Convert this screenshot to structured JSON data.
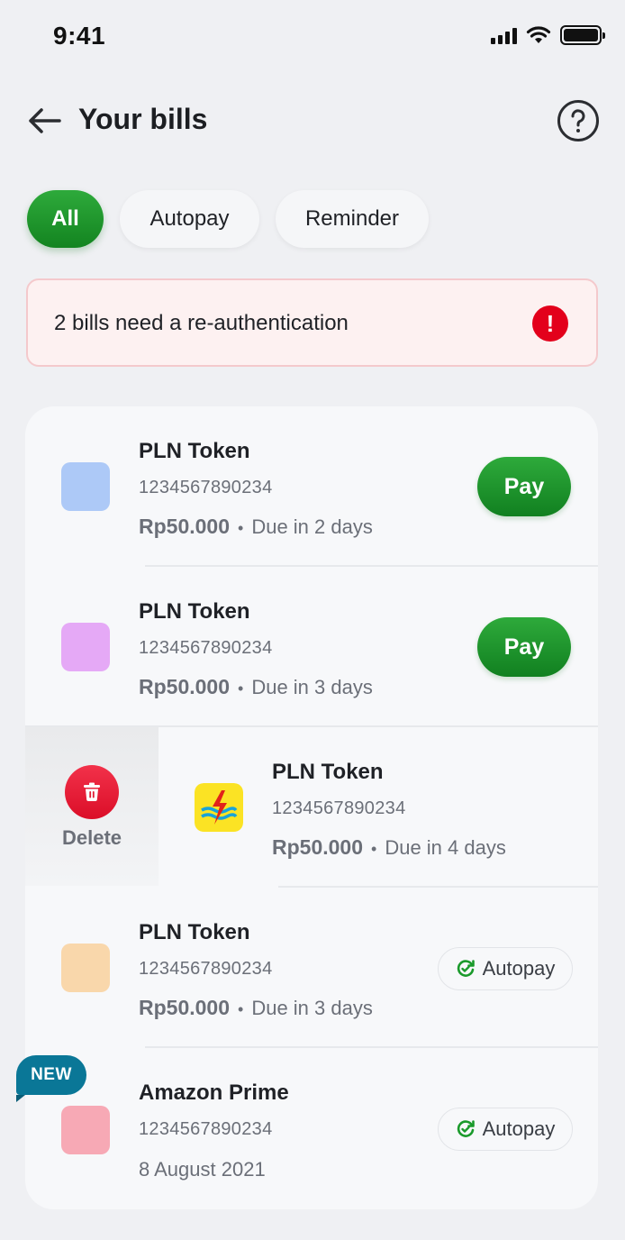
{
  "status_bar": {
    "time": "9:41"
  },
  "header": {
    "title": "Your bills"
  },
  "filters": [
    {
      "label": "All",
      "active": true
    },
    {
      "label": "Autopay",
      "active": false
    },
    {
      "label": "Reminder",
      "active": false
    }
  ],
  "alert": {
    "text": "2 bills need a re-authentication",
    "icon": "!"
  },
  "bills": [
    {
      "name": "PLN Token",
      "number": "1234567890234",
      "amount": "Rp50.000",
      "separator": "•",
      "due": "Due in 2 days",
      "action": "Pay",
      "logo_color": "#adc9f7"
    },
    {
      "name": "PLN Token",
      "number": "1234567890234",
      "amount": "Rp50.000",
      "separator": "•",
      "due": "Due in 3 days",
      "action": "Pay",
      "logo_color": "#e5a9f6"
    },
    {
      "name": "PLN Token",
      "number": "1234567890234",
      "amount": "Rp50.000",
      "separator": "•",
      "due": "Due in 4 days",
      "swipe_action": "Delete",
      "logo": "pln-logo"
    },
    {
      "name": "PLN Token",
      "number": "1234567890234",
      "amount": "Rp50.000",
      "separator": "•",
      "due": "Due in 3 days",
      "action": "Autopay",
      "logo_color": "#f9d7ab"
    },
    {
      "name": "Amazon Prime",
      "number": "1234567890234",
      "date": "8 August 2021",
      "action": "Autopay",
      "badge": "NEW",
      "logo_color": "#f7a9b5"
    }
  ],
  "colors": {
    "primary_green": "#1a9a2b",
    "alert_red": "#e3001b",
    "new_badge": "#0a7797"
  }
}
